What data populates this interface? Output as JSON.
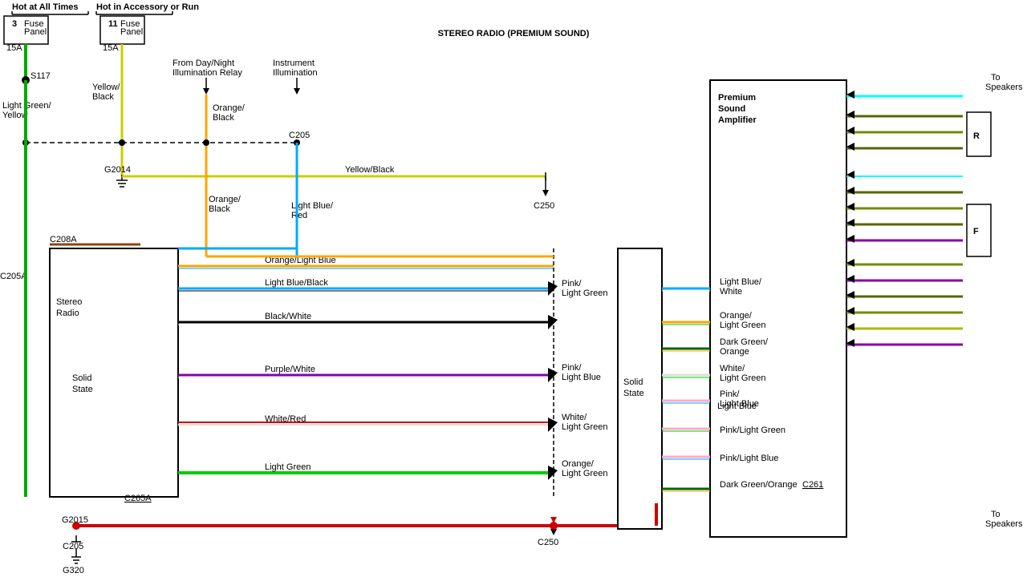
{
  "title": "STEREO RADIO (PREMIUM SOUND)",
  "diagram": {
    "title": "STEREO RADIO (PREMIUM SOUND)",
    "labels": {
      "hot_at_all_times": "Hot at All Times",
      "hot_in_accessory": "Hot in Accessory or Run",
      "fuse_panel_1": "Fuse Panel",
      "fuse_panel_2": "Fuse Panel",
      "fuse_15a_1": "15A",
      "fuse_3": "3",
      "fuse_11": "11",
      "fuse_15a_2": "15A",
      "s117": "S117",
      "light_green_yellow": "Light Green/ Yellow",
      "yellow_black": "Yellow/ Black",
      "from_day_night": "From Day/Night Illumination Relay",
      "orange_black_top": "Orange/ Black",
      "instrument_illumination": "Instrument Illumination",
      "c205": "C205",
      "g2014": "G2014",
      "orange_black": "Orange/ Black",
      "light_blue_red": "Light Blue/ Red",
      "c208a_top": "C208A",
      "c205a": "C205A",
      "stereo_radio": "Stereo Radio",
      "solid_state_left": "Solid State",
      "c265a": "C265A",
      "g2015": "G2015",
      "c205_bot": "C205",
      "g320": "G320",
      "yellow_black_line": "Yellow/Black",
      "c250_top": "C250",
      "orange_light_blue": "Orange/Light Blue",
      "light_blue_black": "Light Blue/Black",
      "pink_light_green_top": "Pink/ Light Green",
      "black_white": "Black/White",
      "purple_white": "Purple/White",
      "pink_light_blue_mid": "Pink/ Light Blue",
      "white_red": "White/Red",
      "white_light_green": "White/ Light Green",
      "light_green": "Light Green",
      "orange_light_green_bot": "Orange/ Light Green",
      "c250_bot": "C250",
      "solid_state_right": "Solid State",
      "premium_sound_amplifier": "Premium Sound Amplifier",
      "light_blue_white": "Light Blue/ White",
      "orange_light_green_amp": "Orange/ Light Green",
      "dark_green_orange_amp": "Dark Green/ Orange",
      "white_light_green_amp": "White/ Light Green",
      "pink_light_blue_amp": "Pink/ Light Blue",
      "pink_light_green_amp": "Pink/Light Green",
      "pink_light_blue_amp2": "Pink/Light Blue",
      "dark_green_orange_bot": "Dark Green/Orange",
      "c261": "C261",
      "to_speakers_top": "To Speakers",
      "to_speakers_bot": "To Speakers",
      "r_label": "R",
      "f_label": "F",
      "light_blue": "Light Blue"
    }
  }
}
